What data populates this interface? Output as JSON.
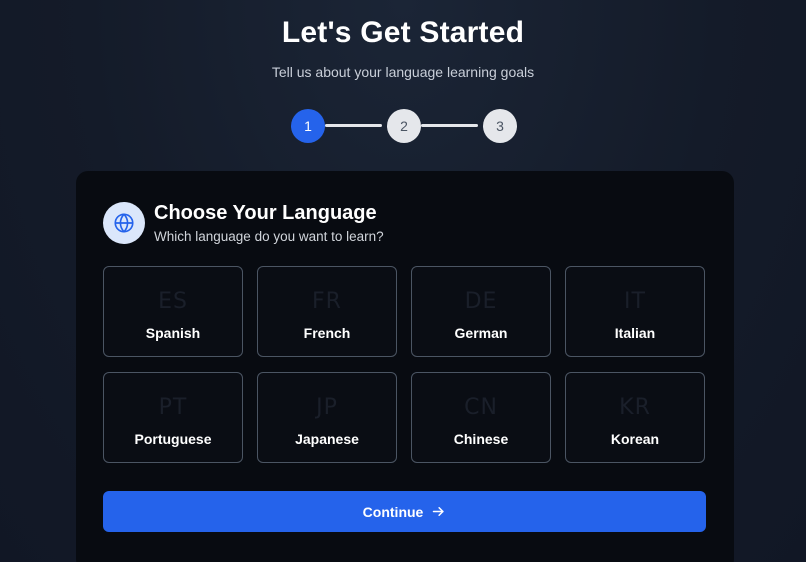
{
  "header": {
    "title": "Let's Get Started",
    "subtitle": "Tell us about your language learning goals"
  },
  "stepper": {
    "current": 1,
    "steps": [
      "1",
      "2",
      "3"
    ],
    "active_color": "#2563eb",
    "inactive_color": "#e5e7eb"
  },
  "card": {
    "icon": "globe-icon",
    "title": "Choose Your Language",
    "subtitle": "Which language do you want to learn?",
    "languages": [
      {
        "code": "ES",
        "name": "Spanish"
      },
      {
        "code": "FR",
        "name": "French"
      },
      {
        "code": "DE",
        "name": "German"
      },
      {
        "code": "IT",
        "name": "Italian"
      },
      {
        "code": "PT",
        "name": "Portuguese"
      },
      {
        "code": "JP",
        "name": "Japanese"
      },
      {
        "code": "CN",
        "name": "Chinese"
      },
      {
        "code": "KR",
        "name": "Korean"
      }
    ],
    "continue_label": "Continue",
    "continue_icon": "arrow-right-icon"
  }
}
